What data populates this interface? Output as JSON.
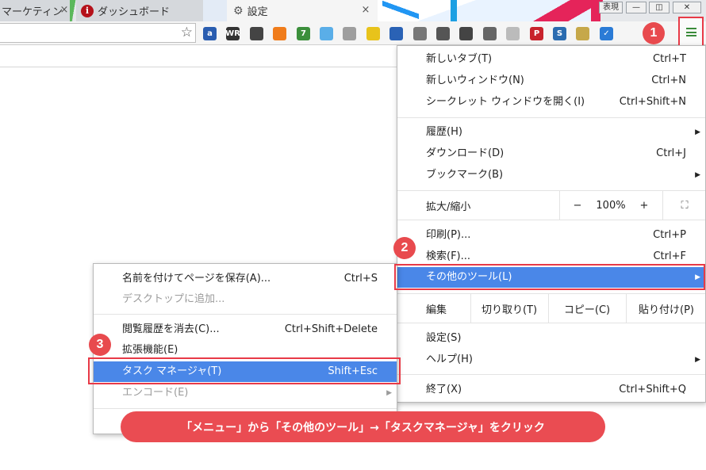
{
  "tabs": [
    {
      "label": "マーケティン",
      "active": false
    },
    {
      "label": "ダッシュボード",
      "active": false,
      "favicon": "info-circle-icon"
    },
    {
      "label": "設定",
      "active": true,
      "favicon": "gear-icon"
    }
  ],
  "tab_close_glyph": "×",
  "tab_favicon_letter": "i",
  "window_controls": {
    "profile_label": "表現",
    "minimize": "—",
    "restore": "◫",
    "close": "✕"
  },
  "toolbar": {
    "extensions": [
      {
        "name": "a-icon",
        "text": "a",
        "color": "#2a5db0"
      },
      {
        "name": "wr-icon",
        "text": "WR",
        "color": "#333333"
      },
      {
        "name": "evernote-icon",
        "text": "",
        "color": "#444444"
      },
      {
        "name": "trend-icon",
        "text": "",
        "color": "#f07c1b"
      },
      {
        "name": "pagespeed-icon",
        "text": "7",
        "color": "#3b8f3b"
      },
      {
        "name": "cloud-icon",
        "text": "",
        "color": "#5aaee8"
      },
      {
        "name": "shell-icon",
        "text": "",
        "color": "#9e9e9e"
      },
      {
        "name": "chart-yellow-icon",
        "text": "",
        "color": "#e8c31b"
      },
      {
        "name": "bar-chart-icon",
        "text": "",
        "color": "#2a62b5"
      },
      {
        "name": "check-icon",
        "text": "",
        "color": "#777777"
      },
      {
        "name": "ruler-icon",
        "text": "",
        "color": "#555555"
      },
      {
        "name": "screen-icon",
        "text": "",
        "color": "#444444"
      },
      {
        "name": "hand-icon",
        "text": "",
        "color": "#666666"
      },
      {
        "name": "shield-icon",
        "text": "",
        "color": "#bbbbbb"
      },
      {
        "name": "pinterest-icon",
        "text": "P",
        "color": "#c8232c"
      },
      {
        "name": "s-icon",
        "text": "S",
        "color": "#2b6cb0"
      },
      {
        "name": "battery-icon",
        "text": "",
        "color": "#c6a84a"
      },
      {
        "name": "blue-check-icon",
        "text": "✓",
        "color": "#2b7bd6"
      }
    ],
    "star_glyph": "☆"
  },
  "main_menu": {
    "items": [
      {
        "label": "新しいタブ(T)",
        "shortcut": "Ctrl+T"
      },
      {
        "label": "新しいウィンドウ(N)",
        "shortcut": "Ctrl+N"
      },
      {
        "label": "シークレット ウィンドウを開く(I)",
        "shortcut": "Ctrl+Shift+N"
      },
      {
        "label": "履歴(H)",
        "shortcut": "",
        "submenu": true
      },
      {
        "label": "ダウンロード(D)",
        "shortcut": "Ctrl+J"
      },
      {
        "label": "ブックマーク(B)",
        "shortcut": "",
        "submenu": true
      },
      {
        "label": "印刷(P)...",
        "shortcut": "Ctrl+P"
      },
      {
        "label": "検索(F)...",
        "shortcut": "Ctrl+F"
      },
      {
        "label": "その他のツール(L)",
        "shortcut": "",
        "submenu": true,
        "highlighted": true
      },
      {
        "label": "設定(S)",
        "shortcut": ""
      },
      {
        "label": "ヘルプ(H)",
        "shortcut": "",
        "submenu": true
      },
      {
        "label": "終了(X)",
        "shortcut": "Ctrl+Shift+Q"
      }
    ],
    "zoom": {
      "label": "拡大/縮小",
      "minus": "−",
      "value": "100%",
      "plus": "+",
      "fullscreen": "⛶"
    },
    "edit": {
      "label": "編集",
      "cut": "切り取り(T)",
      "copy": "コピー(C)",
      "paste": "貼り付け(P)"
    }
  },
  "submenu": {
    "items": [
      {
        "label": "名前を付けてページを保存(A)...",
        "shortcut": "Ctrl+S"
      },
      {
        "label": "デスクトップに追加...",
        "shortcut": "",
        "disabled": true
      },
      {
        "label": "閲覧履歴を消去(C)...",
        "shortcut": "Ctrl+Shift+Delete"
      },
      {
        "label": "拡張機能(E)",
        "shortcut": ""
      },
      {
        "label": "タスク マネージャ(T)",
        "shortcut": "Shift+Esc",
        "highlighted": true
      },
      {
        "label": "エンコード(E)",
        "shortcut": "",
        "submenu": true,
        "disabled": true
      }
    ]
  },
  "arrow_glyph": "▶",
  "badges": [
    "1",
    "2",
    "3"
  ],
  "callout": "「メニュー」から「その他のツール」→「タスクマネージャ」をクリック",
  "colors": {
    "accent_red": "#e83a47",
    "menu_highlight": "#4a87e8"
  }
}
